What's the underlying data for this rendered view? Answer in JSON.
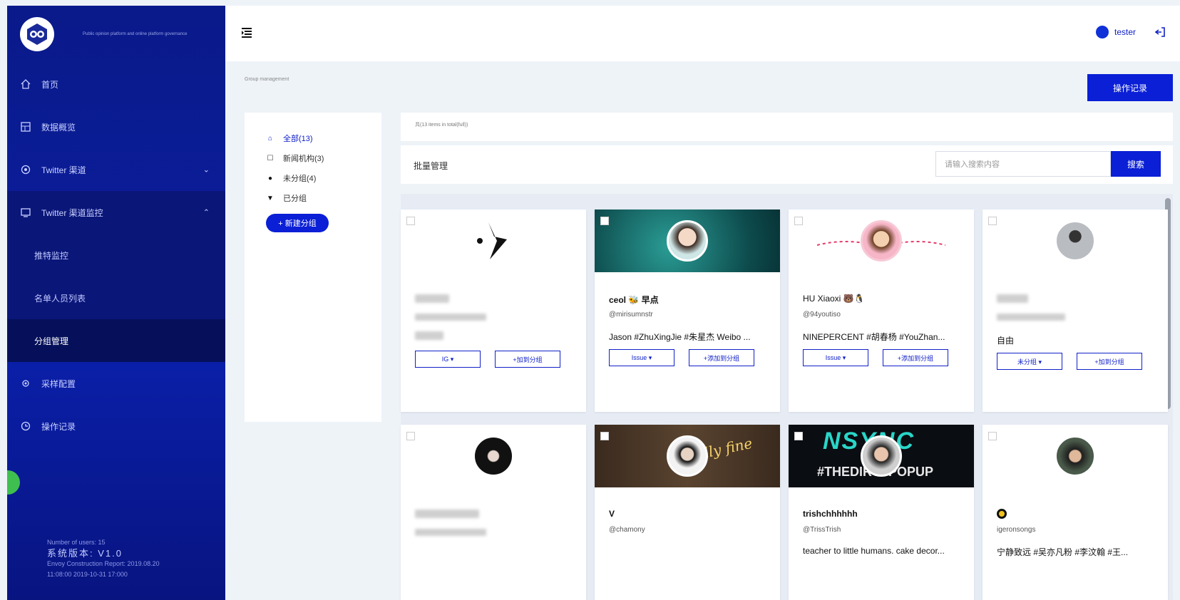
{
  "brand": {
    "tagline": "Public opinion platform and online platform governance"
  },
  "sidebar": {
    "items": [
      {
        "label": "首页",
        "icon": "home-icon"
      },
      {
        "label": "数据概览",
        "icon": "dashboard-icon"
      },
      {
        "label": "Twitter 渠道",
        "icon": "globe-icon"
      },
      {
        "label": "Twitter 渠道监控",
        "icon": "monitor-icon"
      },
      {
        "label": "采样配置",
        "icon": "settings-icon"
      },
      {
        "label": "操作记录",
        "icon": "clock-icon"
      }
    ],
    "sub_items": [
      "推特监控",
      "名单人员列表",
      "分组管理"
    ],
    "footer": {
      "users": "Number of users: 15",
      "version": "系统版本: V1.0",
      "report": "Envoy Construction Report: 2019.08.20",
      "date": "11:08:00 2019-10-31 17:000"
    }
  },
  "header": {
    "username": "tester"
  },
  "breadcrumb": "Group management",
  "op_button": "操作记录",
  "groups": {
    "items": [
      {
        "label": "全部(13)",
        "icon": "home-icon"
      },
      {
        "label": "新闻机构(3)",
        "icon": "tag-icon"
      },
      {
        "label": "未分组(4)",
        "icon": "dot-icon"
      },
      {
        "label": "已分组",
        "icon": "caret-down-icon"
      }
    ],
    "new_group": "+ 新建分组"
  },
  "info": "共(13 items in total(full))",
  "filter": {
    "batch": "批量管理",
    "search_placeholder": "请输入搜索内容",
    "search_button": "搜索"
  },
  "cards": [
    {
      "name": "",
      "handle": "",
      "bio": "",
      "btn1": "IG ▾",
      "btn2": "+加到分组"
    },
    {
      "name": "ceol 🐝 早点",
      "handle": "@mirisumnstr",
      "bio": "Jason #ZhuXingJie #朱星杰 Weibo ...",
      "btn1": "Issue ▾",
      "btn2": "+添加到分组"
    },
    {
      "name": "HU Xiaoxi 🐻🐧",
      "handle": "@94youtiso",
      "bio": "NINEPERCENT #胡春杨 #YouZhan...",
      "btn1": "Issue ▾",
      "btn2": "+添加到分组"
    },
    {
      "name": "",
      "handle": "",
      "bio": "自由",
      "btn1": "未分组 ▾",
      "btn2": "+加到分组"
    },
    {
      "name": "",
      "handle": "",
      "bio": ""
    },
    {
      "name": "V",
      "handle": "@chamony",
      "bio": ""
    },
    {
      "name": "trishchhhhhh",
      "handle": "@TrissTrish",
      "bio": "teacher to little humans. cake decor..."
    },
    {
      "name": "",
      "handle": "igeronsongs",
      "bio": "宁静致远 #吴亦凡粉 #李汶翰 #王..."
    }
  ],
  "banners": {
    "card6_text": "really fine",
    "card7_line1": "NSYNC",
    "card7_line2": "#THEDIRTYPOPUP"
  }
}
